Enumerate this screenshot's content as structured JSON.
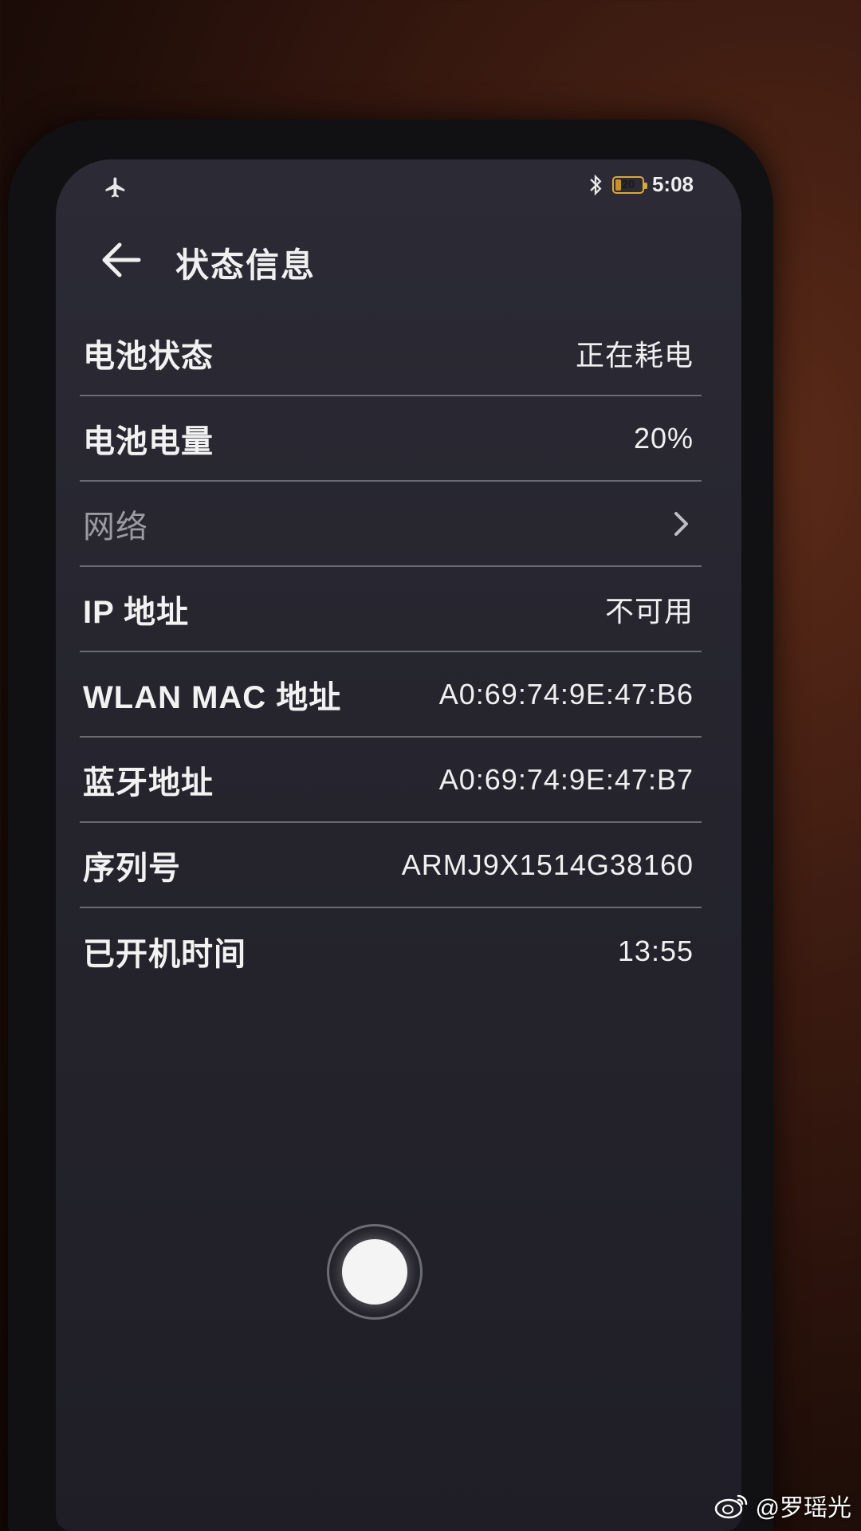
{
  "status_bar": {
    "battery_level": "20",
    "battery_fraction": 0.2,
    "time": "5:08",
    "icons": [
      "airplane-icon",
      "bluetooth-icon",
      "battery-icon"
    ]
  },
  "header": {
    "title": "状态信息",
    "back_icon": "back-arrow-icon"
  },
  "rows": [
    {
      "label": "电池状态",
      "value": "正在耗电"
    },
    {
      "label": "电池电量",
      "value": "20%"
    },
    {
      "label": "网络",
      "value": "",
      "icon": "chevron-right-icon"
    },
    {
      "label": "IP 地址",
      "value": "不可用"
    },
    {
      "label": "WLAN MAC 地址",
      "value": "A0:69:74:9E:47:B6"
    },
    {
      "label": "蓝牙地址",
      "value": "A0:69:74:9E:47:B7"
    },
    {
      "label": "序列号",
      "value": "ARMJ9X1514G38160"
    },
    {
      "label": "已开机时间",
      "value": "13:55"
    }
  ],
  "watermark": {
    "text": "@罗瑶光",
    "icon": "weibo-icon"
  },
  "colors": {
    "screen_bg": "#26252e",
    "text": "#f0f0f0",
    "dim_text": "#9a9aa0",
    "divider": "#6a6a72",
    "battery_accent": "#d9a93a"
  }
}
